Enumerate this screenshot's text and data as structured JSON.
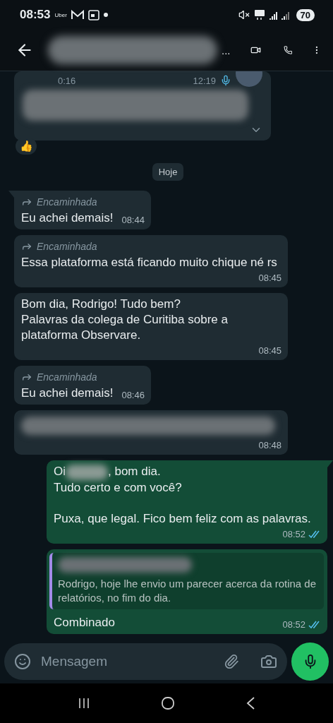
{
  "status_bar": {
    "time": "08:53",
    "app_label": "Uber",
    "battery": "70"
  },
  "header": {
    "title_visible": "..."
  },
  "date_chip": "Hoje",
  "top_message": {
    "duration": "0:16",
    "time": "12:19",
    "reaction": "👍"
  },
  "messages": [
    {
      "kind": "text",
      "outgoing": false,
      "tail": true,
      "forwarded": true,
      "forward_label": "Encaminhada",
      "text": "Eu achei demais!",
      "time": "08:44"
    },
    {
      "kind": "text",
      "outgoing": false,
      "tail": false,
      "forwarded": true,
      "forward_label": "Encaminhada",
      "text": "Essa plataforma está ficando muito chique né rs",
      "time": "08:45"
    },
    {
      "kind": "text",
      "outgoing": false,
      "tail": false,
      "forwarded": false,
      "text": "Bom dia, Rodrigo! Tudo bem?\nPalavras da colega de Curitiba sobre a plataforma Observare.",
      "time": "08:45"
    },
    {
      "kind": "text",
      "outgoing": false,
      "tail": false,
      "forwarded": true,
      "forward_label": "Encaminhada",
      "text": "Eu achei demais!",
      "time": "08:46"
    },
    {
      "kind": "hidden",
      "outgoing": false,
      "tail": false,
      "forwarded": false,
      "time": "08:48"
    },
    {
      "kind": "greeting",
      "outgoing": true,
      "tail": true,
      "forwarded": false,
      "before": "Oi",
      "after": ", bom dia.\nTudo certo e com você?\n\nPuxa, que legal. Fico bem feliz com as palavras.",
      "time": "08:52",
      "read": true
    },
    {
      "kind": "reply",
      "outgoing": true,
      "tail": false,
      "forwarded": false,
      "quote": "Rodrigo, hoje lhe envio um parecer acerca da rotina de relatórios, no fim do dia.",
      "text": "Combinado",
      "time": "08:52",
      "read": true
    }
  ],
  "composer": {
    "placeholder": "Mensagem"
  }
}
